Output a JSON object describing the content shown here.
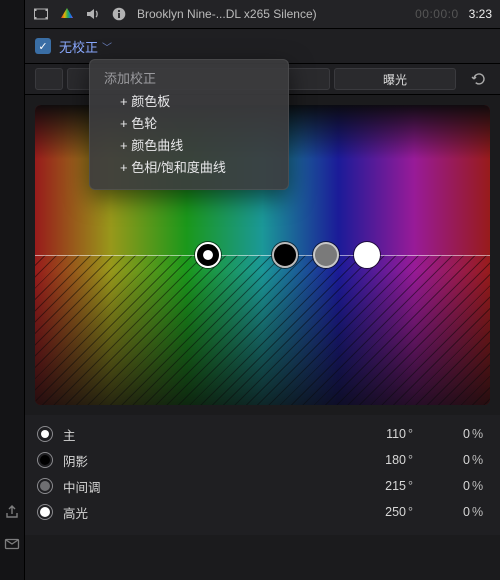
{
  "topbar": {
    "clip_title": "Brooklyn Nine-...DL x265 Silence)",
    "timecode_inactive": "00:00:0",
    "timecode_active": "3:23"
  },
  "toolbar": {
    "correction_dropdown_label": "无校正"
  },
  "menu": {
    "title": "添加校正",
    "items": [
      "+ 颜色板",
      "+ 色轮",
      "+ 颜色曲线",
      "+ 色相/饱和度曲线"
    ]
  },
  "segmented": {
    "exposure_label": "曝光"
  },
  "params": {
    "rows": [
      {
        "name": "主",
        "angle": "110",
        "angle_unit": "°",
        "value": "0",
        "value_unit": "%"
      },
      {
        "name": "阴影",
        "angle": "180",
        "angle_unit": "°",
        "value": "0",
        "value_unit": "%"
      },
      {
        "name": "中间调",
        "angle": "215",
        "angle_unit": "°",
        "value": "0",
        "value_unit": "%"
      },
      {
        "name": "高光",
        "angle": "250",
        "angle_unit": "°",
        "value": "0",
        "value_unit": "%"
      }
    ]
  }
}
